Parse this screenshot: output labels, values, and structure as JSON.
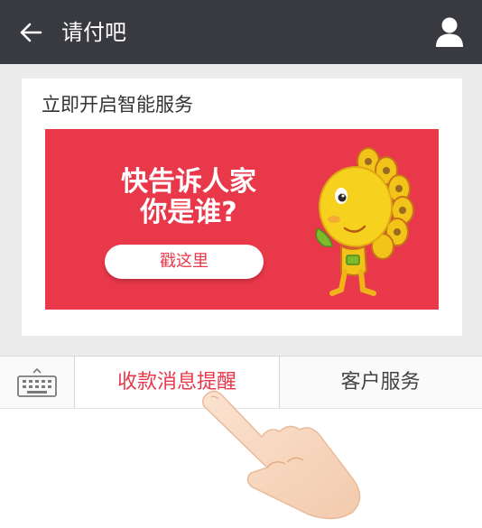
{
  "header": {
    "title": "请付吧",
    "back_icon": "arrow-left-icon",
    "user_icon": "user-icon",
    "background": "#393a3f"
  },
  "card": {
    "title": "立即开启智能服务",
    "banner": {
      "headline_line1": "快告诉人家",
      "headline_line2": "你是谁?",
      "button_label": "戳这里",
      "background": "#e8384a"
    }
  },
  "bottom_menu": {
    "keyboard_icon": "keyboard-icon",
    "items": [
      {
        "label": "收款消息提醒",
        "active": true
      },
      {
        "label": "客户服务",
        "active": false
      }
    ],
    "accent": "#e8384a"
  }
}
